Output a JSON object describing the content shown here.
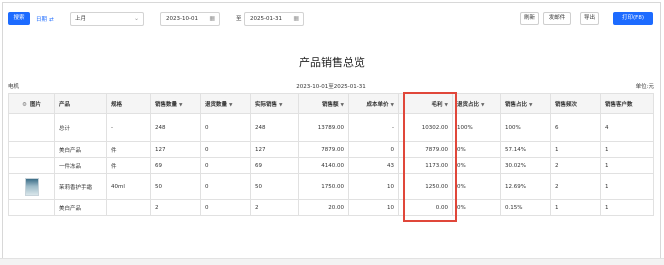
{
  "toolbar": {
    "search_label": "搜索",
    "date_type_label": "日期",
    "date_type_icon": "swap-icon",
    "period_select": "上月",
    "start_date": "2023-10-01",
    "range_separator": "至",
    "end_date": "2025-01-31",
    "refresh_label": "刷新",
    "send_mail_label": "发邮件",
    "export_label": "导出",
    "print_label": "打印(F8)"
  },
  "report": {
    "title": "产品销售总览",
    "category": "电机",
    "date_range": "2023-10-01至2025-01-31",
    "unit": "单位:元"
  },
  "table": {
    "headers": [
      "图片",
      "产品",
      "规格",
      "销售数量",
      "退货数量",
      "实际销售",
      "销售额",
      "成本单价",
      "毛利",
      "退货占比",
      "销售占比",
      "销售频次",
      "销售客户数"
    ],
    "sortable": [
      false,
      false,
      false,
      true,
      true,
      true,
      true,
      true,
      true,
      true,
      true,
      false,
      false
    ],
    "rows": [
      {
        "image": "",
        "product": "总计",
        "spec": "-",
        "sales_qty": "248",
        "return_qty": "0",
        "actual_sales": "248",
        "sales_amount": "13789.00",
        "unit_cost": "-",
        "gross_profit": "10302.00",
        "return_ratio": "100%",
        "sales_ratio": "100%",
        "frequency": "6",
        "customers": "4"
      },
      {
        "image": "",
        "product": "美白产品",
        "spec": "件",
        "sales_qty": "127",
        "return_qty": "0",
        "actual_sales": "127",
        "sales_amount": "7879.00",
        "unit_cost": "0",
        "gross_profit": "7879.00",
        "return_ratio": "0%",
        "sales_ratio": "57.14%",
        "frequency": "1",
        "customers": "1"
      },
      {
        "image": "",
        "product": "一件冻品",
        "spec": "件",
        "sales_qty": "69",
        "return_qty": "0",
        "actual_sales": "69",
        "sales_amount": "4140.00",
        "unit_cost": "43",
        "gross_profit": "1173.00",
        "return_ratio": "0%",
        "sales_ratio": "30.02%",
        "frequency": "2",
        "customers": "1"
      },
      {
        "image": "product-thumbnail",
        "product": "茉莉香护手霜",
        "spec": "40ml",
        "sales_qty": "50",
        "return_qty": "0",
        "actual_sales": "50",
        "sales_amount": "1750.00",
        "unit_cost": "10",
        "gross_profit": "1250.00",
        "return_ratio": "0%",
        "sales_ratio": "12.69%",
        "frequency": "2",
        "customers": "1"
      },
      {
        "image": "",
        "product": "美白产品",
        "spec": "",
        "sales_qty": "2",
        "return_qty": "0",
        "actual_sales": "2",
        "sales_amount": "20.00",
        "unit_cost": "10",
        "gross_profit": "0.00",
        "return_ratio": "0%",
        "sales_ratio": "0.15%",
        "frequency": "1",
        "customers": "1"
      }
    ]
  },
  "colors": {
    "primary": "#1d6bff",
    "highlight": "#e0473a",
    "header_bg": "#f5f5f5"
  }
}
